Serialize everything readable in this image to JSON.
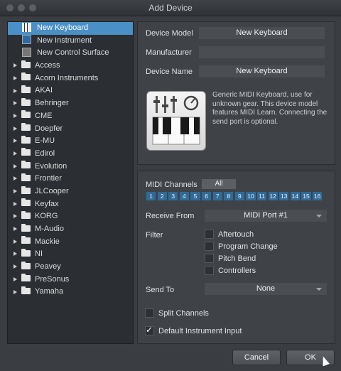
{
  "window": {
    "title": "Add Device"
  },
  "tree": {
    "items": [
      {
        "label": "New Keyboard",
        "type": "device",
        "icon": "keyboard-icon",
        "selected": true
      },
      {
        "label": "New Instrument",
        "type": "device",
        "icon": "instrument-icon"
      },
      {
        "label": "New Control Surface",
        "type": "device",
        "icon": "control-surface-icon"
      },
      {
        "label": "Access",
        "type": "folder"
      },
      {
        "label": "Acorn Instruments",
        "type": "folder"
      },
      {
        "label": "AKAI",
        "type": "folder"
      },
      {
        "label": "Behringer",
        "type": "folder"
      },
      {
        "label": "CME",
        "type": "folder"
      },
      {
        "label": "Doepfer",
        "type": "folder"
      },
      {
        "label": "E-MU",
        "type": "folder"
      },
      {
        "label": "Edirol",
        "type": "folder"
      },
      {
        "label": "Evolution",
        "type": "folder"
      },
      {
        "label": "Frontier",
        "type": "folder"
      },
      {
        "label": "JLCooper",
        "type": "folder"
      },
      {
        "label": "Keyfax",
        "type": "folder"
      },
      {
        "label": "KORG",
        "type": "folder"
      },
      {
        "label": "M-Audio",
        "type": "folder"
      },
      {
        "label": "Mackie",
        "type": "folder"
      },
      {
        "label": "NI",
        "type": "folder"
      },
      {
        "label": "Peavey",
        "type": "folder"
      },
      {
        "label": "PreSonus",
        "type": "folder"
      },
      {
        "label": "Yamaha",
        "type": "folder"
      }
    ]
  },
  "device": {
    "model_label": "Device Model",
    "model_value": "New Keyboard",
    "manufacturer_label": "Manufacturer",
    "manufacturer_value": "",
    "name_label": "Device Name",
    "name_value": "New Keyboard",
    "description": "Generic MIDI Keyboard, use for unknown gear. This device model features MIDI Learn. Connecting the send port is optional."
  },
  "midi": {
    "channels_label": "MIDI Channels",
    "all_label": "All",
    "channels": [
      "1",
      "2",
      "3",
      "4",
      "5",
      "6",
      "7",
      "8",
      "9",
      "10",
      "11",
      "12",
      "13",
      "14",
      "15",
      "16"
    ],
    "receive_label": "Receive From",
    "receive_value": "MIDI Port #1",
    "filter_label": "Filter",
    "filters": [
      "Aftertouch",
      "Program Change",
      "Pitch Bend",
      "Controllers"
    ],
    "send_label": "Send To",
    "send_value": "None",
    "split_label": "Split Channels",
    "split_checked": false,
    "default_label": "Default Instrument Input",
    "default_checked": true
  },
  "buttons": {
    "cancel": "Cancel",
    "ok": "OK"
  },
  "colors": {
    "selection": "#4a8fc6",
    "channel": "#2f6b98"
  }
}
